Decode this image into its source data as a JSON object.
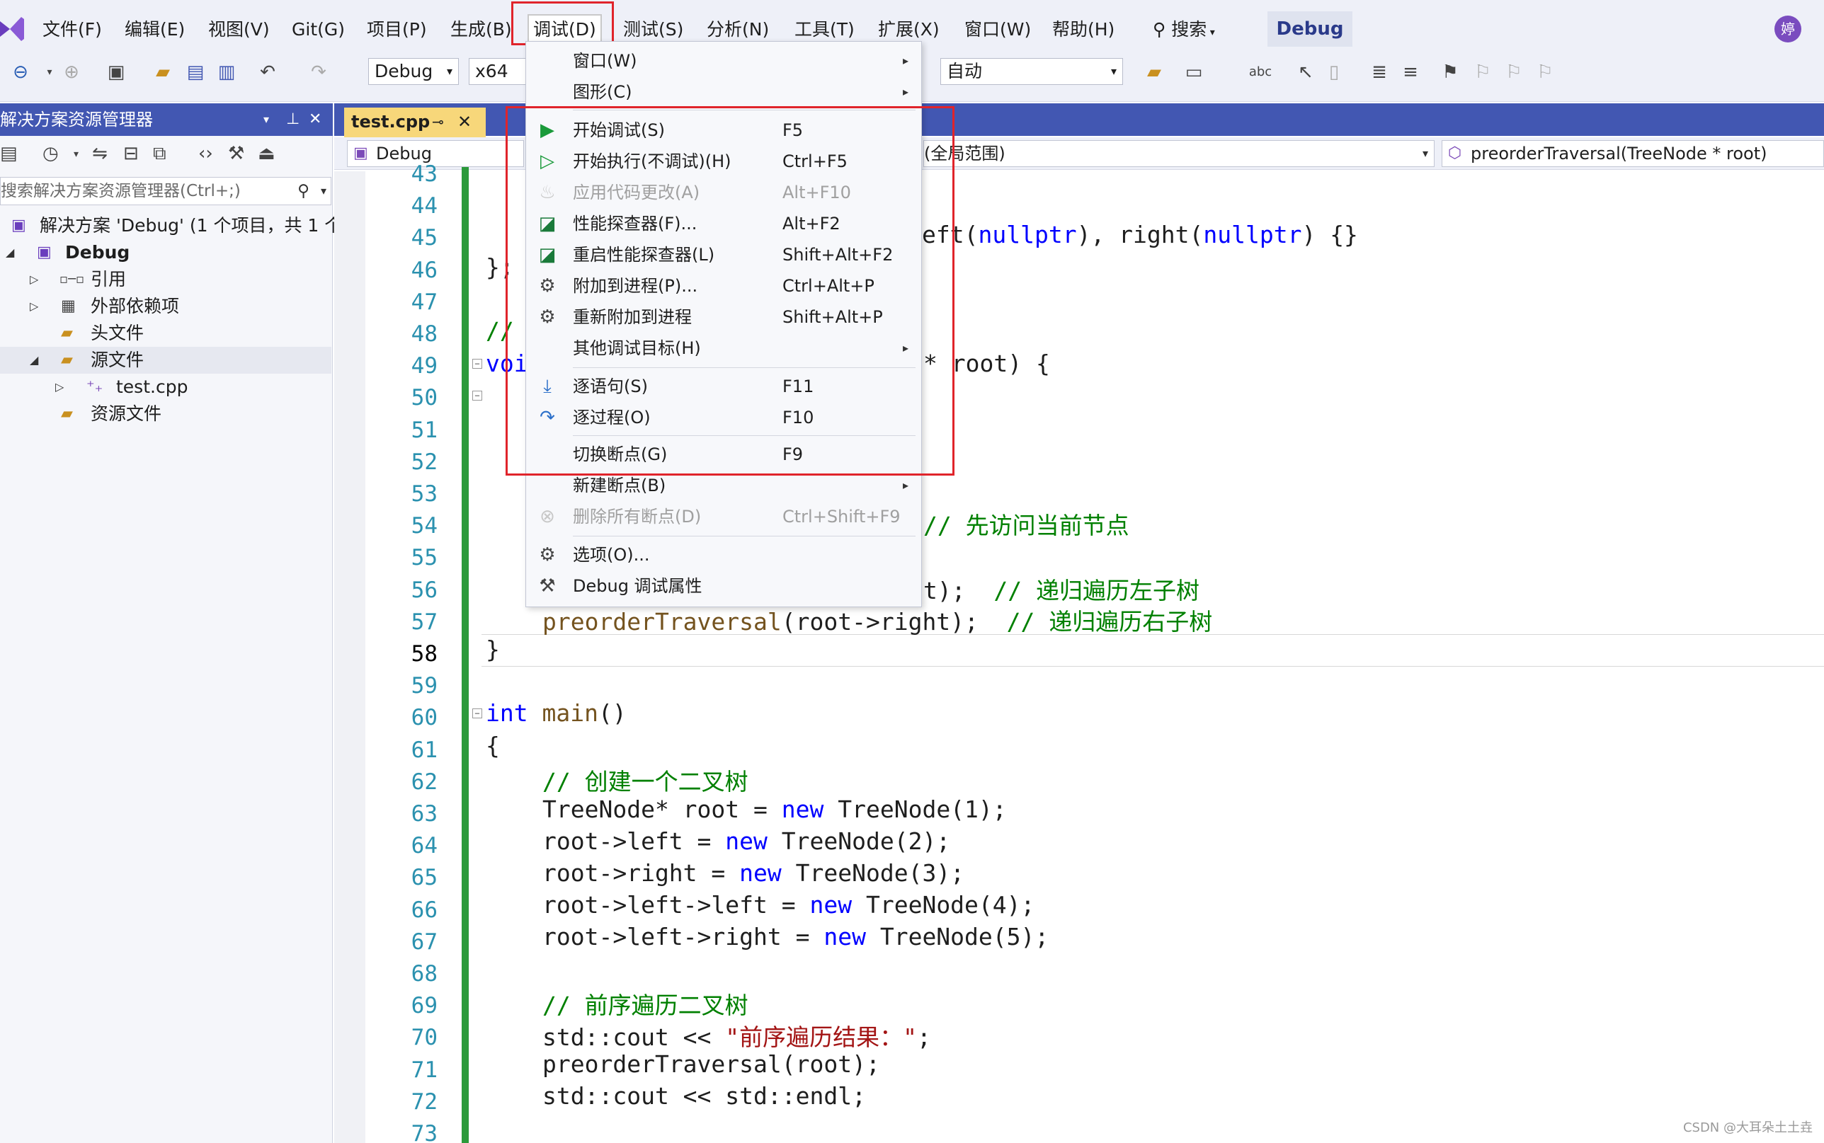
{
  "menubar": {
    "logo": "vs-logo",
    "items": [
      "文件(F)",
      "编辑(E)",
      "视图(V)",
      "Git(G)",
      "项目(P)",
      "生成(B)",
      "调试(D)",
      "测试(S)",
      "分析(N)",
      "工具(T)",
      "扩展(X)",
      "窗口(W)",
      "帮助(H)"
    ],
    "active_item": "调试(D)",
    "search_label": "搜索",
    "config_badge": "Debug",
    "avatar_text": "婷"
  },
  "toolbar": {
    "config_select": "Debug",
    "platform_select": "x64",
    "target_select": "自动",
    "icons": [
      "back-icon",
      "forward-icon",
      "new-project-icon",
      "open-icon",
      "save-icon",
      "save-all-icon",
      "undo-icon",
      "redo-icon",
      "browser-icon",
      "bookmark-icon"
    ]
  },
  "solution_explorer": {
    "title": "解决方案资源管理器",
    "search_placeholder": "搜索解决方案资源管理器(Ctrl+;)",
    "tree": [
      {
        "label": "解决方案 'Debug' (1 个项目，共 1 个)",
        "icon": "solution-icon"
      },
      {
        "label": "Debug",
        "icon": "project-icon"
      },
      {
        "label": "引用",
        "icon": "references-icon"
      },
      {
        "label": "外部依赖项",
        "icon": "external-deps-icon"
      },
      {
        "label": "头文件",
        "icon": "filter-folder-icon"
      },
      {
        "label": "源文件",
        "icon": "filter-folder-icon"
      },
      {
        "label": "test.cpp",
        "icon": "cpp-file-icon"
      },
      {
        "label": "资源文件",
        "icon": "filter-folder-icon"
      }
    ]
  },
  "editor": {
    "tab_label": "test.cpp",
    "nav_project": "Debug",
    "nav_scope": "(全局范围)",
    "nav_member": "preorderTraversal(TreeNode * root)",
    "line_numbers": [
      "43",
      "44",
      "45",
      "46",
      "47",
      "48",
      "49",
      "50",
      "51",
      "52",
      "53",
      "54",
      "55",
      "56",
      "57",
      "58",
      "59",
      "60",
      "61",
      "62",
      "63",
      "64",
      "65",
      "66",
      "67",
      "68",
      "69",
      "70",
      "71",
      "72",
      "73"
    ],
    "current_line": "58"
  },
  "debug_menu": {
    "items": [
      {
        "label": "窗口(W)",
        "shortcut": "",
        "icon": "",
        "submenu": true,
        "disabled": false
      },
      {
        "label": "图形(C)",
        "shortcut": "",
        "icon": "",
        "submenu": true,
        "disabled": false
      },
      {
        "label": "开始调试(S)",
        "shortcut": "F5",
        "icon": "play-solid-icon",
        "submenu": false,
        "disabled": false
      },
      {
        "label": "开始执行(不调试)(H)",
        "shortcut": "Ctrl+F5",
        "icon": "play-outline-icon",
        "submenu": false,
        "disabled": false
      },
      {
        "label": "应用代码更改(A)",
        "shortcut": "Alt+F10",
        "icon": "flame-icon",
        "submenu": false,
        "disabled": true
      },
      {
        "label": "性能探查器(F)...",
        "shortcut": "Alt+F2",
        "icon": "perf-profiler-icon",
        "submenu": false,
        "disabled": false
      },
      {
        "label": "重启性能探查器(L)",
        "shortcut": "Shift+Alt+F2",
        "icon": "perf-profiler-icon",
        "submenu": false,
        "disabled": false
      },
      {
        "label": "附加到进程(P)...",
        "shortcut": "Ctrl+Alt+P",
        "icon": "attach-gears-icon",
        "submenu": false,
        "disabled": false
      },
      {
        "label": "重新附加到进程",
        "shortcut": "Shift+Alt+P",
        "icon": "attach-gears-icon",
        "submenu": false,
        "disabled": false
      },
      {
        "label": "其他调试目标(H)",
        "shortcut": "",
        "icon": "",
        "submenu": true,
        "disabled": false
      },
      {
        "label": "逐语句(S)",
        "shortcut": "F11",
        "icon": "step-into-icon",
        "submenu": false,
        "disabled": false
      },
      {
        "label": "逐过程(O)",
        "shortcut": "F10",
        "icon": "step-over-icon",
        "submenu": false,
        "disabled": false
      },
      {
        "label": "切换断点(G)",
        "shortcut": "F9",
        "icon": "",
        "submenu": false,
        "disabled": false
      },
      {
        "label": "新建断点(B)",
        "shortcut": "",
        "icon": "",
        "submenu": true,
        "disabled": false
      },
      {
        "label": "删除所有断点(D)",
        "shortcut": "Ctrl+Shift+F9",
        "icon": "delete-breakpoints-icon",
        "submenu": false,
        "disabled": true
      },
      {
        "label": "选项(O)...",
        "shortcut": "",
        "icon": "gear-icon",
        "submenu": false,
        "disabled": false
      },
      {
        "label": "Debug 调试属性",
        "shortcut": "",
        "icon": "wrench-icon",
        "submenu": false,
        "disabled": false
      }
    ]
  },
  "code": {
    "l45_tail_a": "eft(",
    "l45_null1": "nullptr",
    "l45_mid": "), right(",
    "l45_null2": "nullptr",
    "l45_end": ") {}",
    "l46": "};",
    "l48": "//",
    "l49_kw": "voi",
    "l49_tail": "* root) {",
    "l54_cm": "// 先访问当前节点",
    "l56_tail": "t);",
    "l56_cm": "// 递归遍历左子树",
    "l57_fn": "preorderTraversal",
    "l57_rest": "(root->right);",
    "l57_cm": "// 递归遍历右子树",
    "l58": "}",
    "l60_kw": "int",
    "l60_fn": "main",
    "l60_rest": "()",
    "l61": "{",
    "l62": "// 创建一个二叉树",
    "l63_a": "TreeNode* root = ",
    "l63_new": "new",
    "l63_b": " TreeNode(1);",
    "l64_a": "root->left = ",
    "l64_new": "new",
    "l64_b": " TreeNode(2);",
    "l65_a": "root->right = ",
    "l65_new": "new",
    "l65_b": " TreeNode(3);",
    "l66_a": "root->left->left = ",
    "l66_new": "new",
    "l66_b": " TreeNode(4);",
    "l67_a": "root->left->right = ",
    "l67_new": "new",
    "l67_b": " TreeNode(5);",
    "l69": "// 前序遍历二叉树",
    "l70_a": "std::cout << ",
    "l70_str": "\"前序遍历结果：\"",
    "l70_b": ";",
    "l71": "preorderTraversal(root);",
    "l72": "std::cout << std::endl;"
  },
  "watermark": "CSDN @大耳朵土土垚",
  "colors": {
    "accent": "#4257b2",
    "annotation": "#e0242b",
    "change_bar": "#2b9a3a",
    "tab_active": "#f7d77a"
  }
}
